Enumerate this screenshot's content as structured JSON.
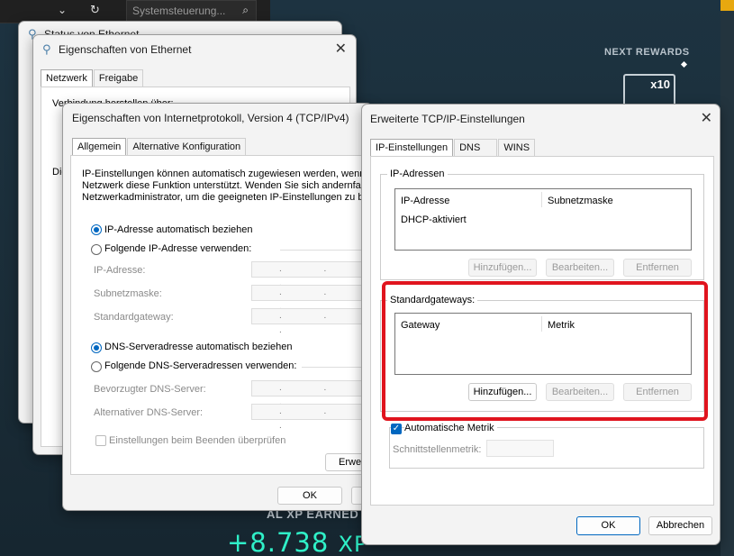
{
  "background": {
    "search_placeholder": "Systemsteuerung...",
    "next_rewards": "NEXT REWARDS",
    "badge_multiplier": "x10",
    "xp_earned_label": "AL XP EARNED",
    "xp_value": "+8.738",
    "xp_suffix": "XP"
  },
  "status_window": {
    "title": "Status von Ethernet"
  },
  "ethernet_props": {
    "title": "Eigenschaften von Ethernet",
    "tabs": [
      "Netzwerk",
      "Freigabe"
    ],
    "connect_label": "Verbindung herstellen über:",
    "partial_label": "Die"
  },
  "ipv4": {
    "title": "Eigenschaften von Internetprotokoll, Version 4 (TCP/IPv4)",
    "tabs": [
      "Allgemein",
      "Alternative Konfiguration"
    ],
    "desc1": "IP-Einstellungen können automatisch zugewiesen werden, wenn d",
    "desc2": "Netzwerk diese Funktion unterstützt. Wenden Sie sich andernfalls",
    "desc3": "Netzwerkadministrator, um die geeigneten IP-Einstellungen zu be",
    "radio_auto_ip": "IP-Adresse automatisch beziehen",
    "radio_manual_ip": "Folgende IP-Adresse verwenden:",
    "ip_label": "IP-Adresse:",
    "mask_label": "Subnetzmaske:",
    "gateway_label": "Standardgateway:",
    "radio_auto_dns": "DNS-Serveradresse automatisch beziehen",
    "radio_manual_dns": "Folgende DNS-Serveradressen verwenden:",
    "dns_pref_label": "Bevorzugter DNS-Server:",
    "dns_alt_label": "Alternativer DNS-Server:",
    "validate_label": "Einstellungen beim Beenden überprüfen",
    "advanced_button": "Erwei",
    "ok_button": "OK",
    "ip_dots": ". . ."
  },
  "advanced": {
    "title": "Erweiterte TCP/IP-Einstellungen",
    "tabs": [
      "IP-Einstellungen",
      "DNS",
      "WINS"
    ],
    "ip_group_label": "IP-Adressen",
    "ip_col1": "IP-Adresse",
    "ip_col2": "Subnetzmaske",
    "ip_row1": "DHCP-aktiviert",
    "add1": "Hinzufügen...",
    "edit1": "Bearbeiten...",
    "remove1": "Entfernen",
    "gw_group_label": "Standardgateways:",
    "gw_col1": "Gateway",
    "gw_col2": "Metrik",
    "add2": "Hinzufügen...",
    "edit2": "Bearbeiten...",
    "remove2": "Entfernen",
    "auto_metric": "Automatische Metrik",
    "interface_metric": "Schnittstellenmetrik:",
    "ok_button": "OK",
    "cancel_button": "Abbrechen",
    "check_mark": "✓",
    "highlight_color": "#e0141e"
  }
}
